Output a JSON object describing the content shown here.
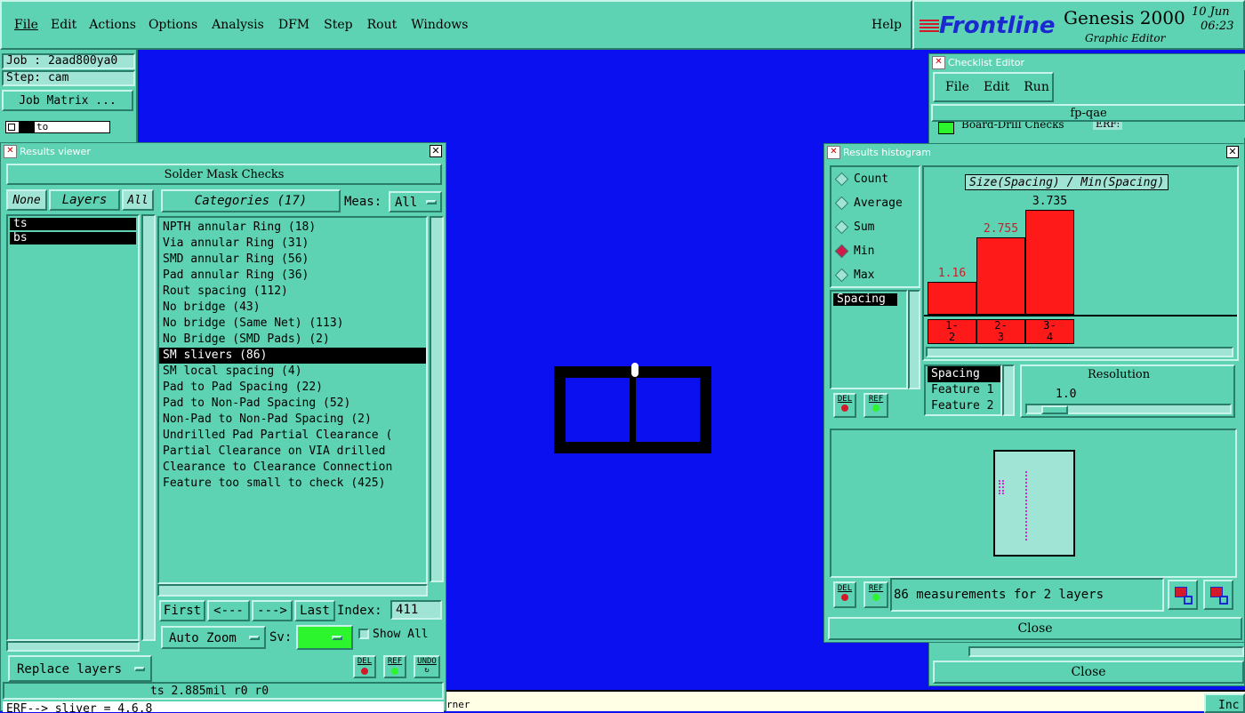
{
  "menubar": {
    "items": [
      "File",
      "Edit",
      "Actions",
      "Options",
      "Analysis",
      "DFM",
      "Step",
      "Rout",
      "Windows"
    ],
    "help": "Help"
  },
  "brand": {
    "logo": "Frontline",
    "product": "Genesis 2000",
    "subtitle": "Graphic Editor",
    "date": "10 Jun",
    "time": "06:23"
  },
  "job_panel": {
    "job": "Job : 2aad800ya0",
    "step": "Step: cam",
    "matrix_button": "Job Matrix ...",
    "layer_row_label": "to"
  },
  "results_viewer": {
    "title": "Results viewer",
    "heading": "Solder Mask Checks",
    "layer_buttons": {
      "none": "None",
      "layers": "Layers",
      "all": "All"
    },
    "layers": [
      "ts",
      "bs"
    ],
    "categories_button": "Categories (17)",
    "meas_label": "Meas:",
    "meas_value": "All",
    "categories": [
      "NPTH annular Ring (18)",
      "Via annular Ring (31)",
      "SMD annular Ring (56)",
      "Pad annular Ring (36)",
      "Rout spacing (112)",
      "No bridge (43)",
      "No bridge (Same Net) (113)",
      "No Bridge (SMD Pads) (2)",
      "SM slivers (86)",
      "SM local spacing (4)",
      "Pad to Pad Spacing (22)",
      "Pad to Non-Pad Spacing (52)",
      "Non-Pad to Non-Pad Spacing (2)",
      "Undrilled Pad Partial Clearance (",
      "Partial Clearance on VIA drilled",
      "Clearance to Clearance Connection",
      "Feature too small to check (425)"
    ],
    "selected_index": 8,
    "nav": {
      "first": "First",
      "prev": "<---",
      "next": "--->",
      "last": "Last",
      "index_label": "Index:",
      "index_value": "411"
    },
    "auto_zoom": "Auto Zoom",
    "sv_label": "Sv:",
    "show_all": "Show All",
    "replace_layers": "Replace layers",
    "icon_labels": {
      "del": "DEL",
      "ref": "REF",
      "undo": "UNDO"
    },
    "status": "ts 2.885mil  r0  r0",
    "erf_line": "ERF--> sliver = 4.6.8"
  },
  "checklist_editor": {
    "title": "Checklist Editor",
    "menu": [
      "File",
      "Edit",
      "Run"
    ],
    "name": "fp-qae",
    "row_text": "Board-Drill Checks",
    "row_erf": "ERF:",
    "close": "Close"
  },
  "histogram": {
    "title": "Results histogram",
    "modes": [
      "Count",
      "Average",
      "Sum",
      "Min",
      "Max"
    ],
    "selected_mode": "Min",
    "list_selected": "Spacing",
    "chart_title": "Size(Spacing) / Min(Spacing)",
    "bars": [
      {
        "label": "1-\n2",
        "value": 1.16,
        "text": "1.16"
      },
      {
        "label": "2-\n3",
        "value": 2.755,
        "text": "2.755"
      },
      {
        "label": "3-\n4",
        "value": 3.735,
        "text": "3.735"
      }
    ],
    "axis_items": [
      "Spacing",
      "Feature 1",
      "Feature 2"
    ],
    "resolution_label": "Resolution",
    "resolution_value": "1.0",
    "measurements": "86 measurements for 2 layers",
    "close": "Close",
    "icon_labels": {
      "del": "DEL",
      "ref": "REF"
    }
  },
  "bottom_status": {
    "text": "rner",
    "right": "Inc"
  },
  "colors": {
    "teal": "#5ed3b3",
    "canvas": "#0a10f0",
    "bar": "#ff1a1a",
    "accent_green": "#2df52d"
  }
}
